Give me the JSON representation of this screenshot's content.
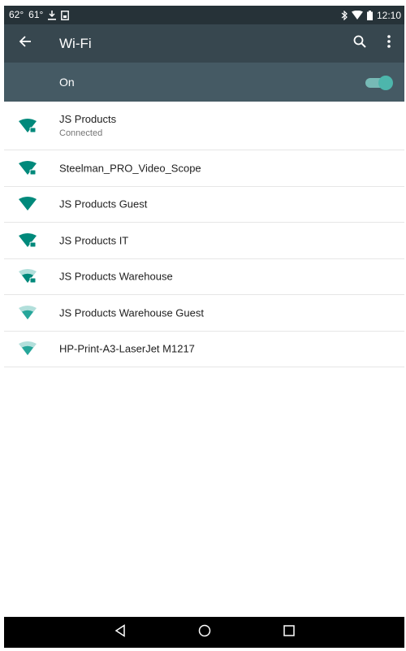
{
  "status_bar": {
    "left_temps": [
      "62°",
      "61°"
    ],
    "download_glyph": "download-icon",
    "clipboard_glyph": "screenshot-icon",
    "right_icons": [
      "bluetooth-icon",
      "wifi-signal-icon",
      "battery-icon"
    ],
    "time": "12:10"
  },
  "toolbar": {
    "back_icon": "arrow-back-icon",
    "title": "Wi-Fi",
    "search_icon": "search-icon",
    "more_icon": "more-vert-icon"
  },
  "wifi_switch": {
    "label": "On",
    "enabled": true
  },
  "networks": [
    {
      "ssid": "JS Products",
      "status": "Connected",
      "signal": "full",
      "secured": true
    },
    {
      "ssid": "Steelman_PRO_Video_Scope",
      "status": "",
      "signal": "full",
      "secured": true
    },
    {
      "ssid": "JS Products Guest",
      "status": "",
      "signal": "full",
      "secured": false
    },
    {
      "ssid": "JS Products IT",
      "status": "",
      "signal": "full",
      "secured": true
    },
    {
      "ssid": "JS Products Warehouse",
      "status": "",
      "signal": "weak",
      "secured": true
    },
    {
      "ssid": "JS Products Warehouse Guest",
      "status": "",
      "signal": "weak",
      "secured": false
    },
    {
      "ssid": "HP-Print-A3-LaserJet M1217",
      "status": "",
      "signal": "weak",
      "secured": false
    }
  ],
  "nav_bar": {
    "back": "nav-back-icon",
    "home": "nav-home-icon",
    "recents": "nav-recents-icon"
  },
  "colors": {
    "status_bar": "#263238",
    "toolbar": "#37474f",
    "switch_bar": "#455a64",
    "accent": "#009688"
  }
}
